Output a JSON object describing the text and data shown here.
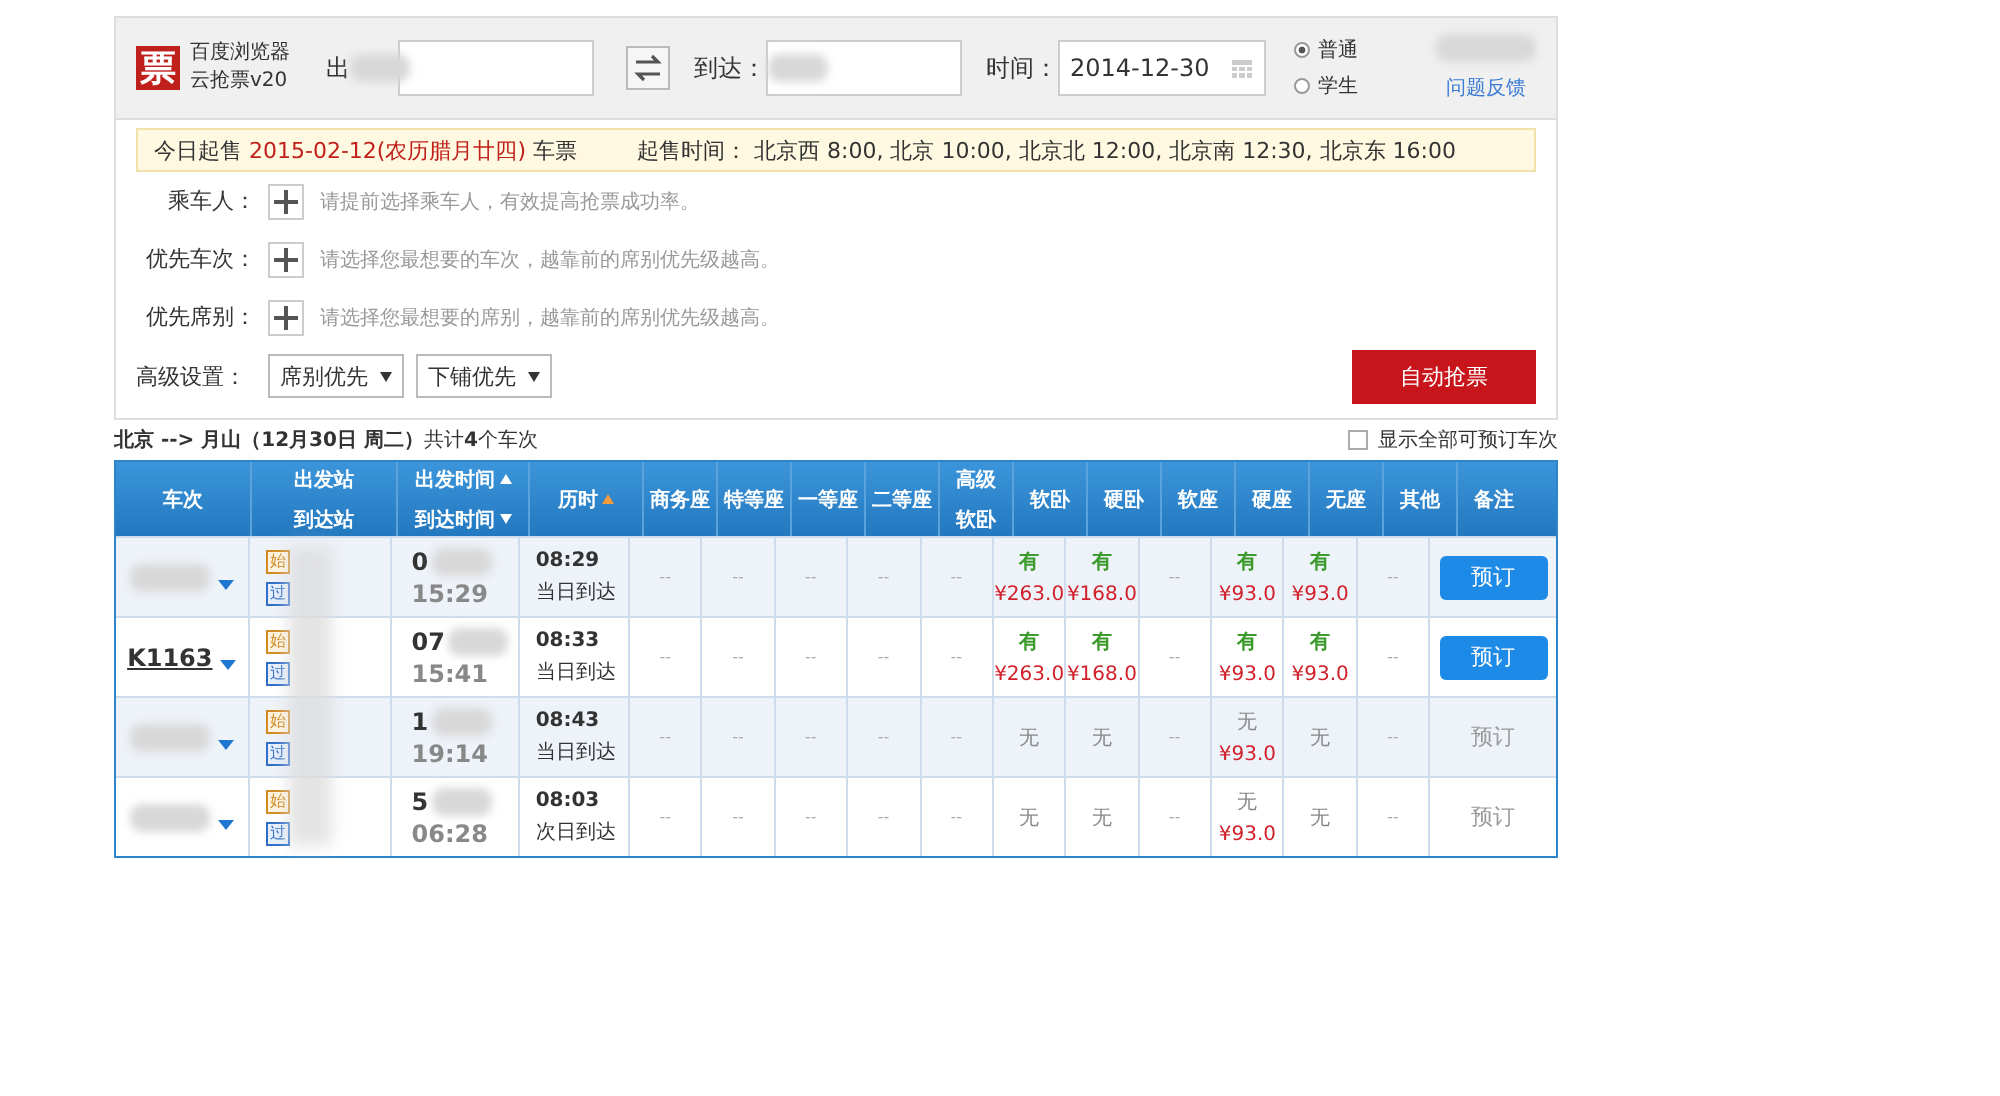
{
  "app": {
    "logo": "票",
    "name_line1": "百度浏览器",
    "name_line2": "云抢票v20"
  },
  "search": {
    "from_label": "出",
    "to_label": "到达：",
    "date_label": "时间：",
    "date": "2014-12-30",
    "ticket_types": [
      {
        "label": "普通",
        "selected": true
      },
      {
        "label": "学生",
        "selected": false
      }
    ],
    "feedback": "问题反馈"
  },
  "notice": {
    "prefix": "今日起售",
    "date": "2015-02-12(农历腊月廿四)",
    "suffix": "车票",
    "times_label": "起售时间：",
    "times": "北京西 8:00, 北京 10:00, 北京北 12:00, 北京南 12:30, 北京东 16:00"
  },
  "form_rows": [
    {
      "label": "乘车人：",
      "hint": "请提前选择乘车人，有效提高抢票成功率。"
    },
    {
      "label": "优先车次：",
      "hint": "请选择您最想要的车次，越靠前的席别优先级越高。"
    },
    {
      "label": "优先席别：",
      "hint": "请选择您最想要的席别，越靠前的席别优先级越高。"
    }
  ],
  "advanced": {
    "label": "高级设置：",
    "selects": [
      "席别优先",
      "下铺优先"
    ],
    "grab_button": "自动抢票"
  },
  "summary": "**北京 --> 月山（12月30日  周二）**共计**4**个车次",
  "show_all": {
    "label": "显示全部可预订车次",
    "checked": false
  },
  "columns": [
    {
      "lines": [
        {
          "text": "车次"
        }
      ]
    },
    {
      "lines": [
        {
          "text": "出发站"
        },
        {
          "text": "到达站"
        }
      ]
    },
    {
      "lines": [
        {
          "text": "出发时间",
          "sort_arrow": true,
          "descending": false,
          "active": false
        },
        {
          "text": "到达时间",
          "sort_arrow": true,
          "descending": true,
          "active": false
        }
      ]
    },
    {
      "lines": [
        {
          "text": "历时",
          "sort_arrow": true,
          "descending": false,
          "active": true
        }
      ]
    },
    {
      "lines": [
        {
          "text": "商务座"
        }
      ]
    },
    {
      "lines": [
        {
          "text": "特等座"
        }
      ]
    },
    {
      "lines": [
        {
          "text": "一等座"
        }
      ]
    },
    {
      "lines": [
        {
          "text": "二等座"
        }
      ]
    },
    {
      "lines": [
        {
          "text": "高级"
        },
        {
          "text": "软卧"
        }
      ]
    },
    {
      "lines": [
        {
          "text": "软卧"
        }
      ]
    },
    {
      "lines": [
        {
          "text": "硬卧"
        }
      ]
    },
    {
      "lines": [
        {
          "text": "软座"
        }
      ]
    },
    {
      "lines": [
        {
          "text": "硬座"
        }
      ]
    },
    {
      "lines": [
        {
          "text": "无座"
        }
      ]
    },
    {
      "lines": [
        {
          "text": "其他"
        }
      ]
    },
    {
      "lines": [
        {
          "text": "备注"
        }
      ]
    }
  ],
  "rows": [
    {
      "depart_shown": "0",
      "arrive": "15:29",
      "duration": "08:29",
      "arrival_day": "当日到达",
      "badges": [
        {
          "text": "始",
          "kind": "start"
        },
        {
          "text": "过",
          "kind": "pass"
        }
      ],
      "seats": [
        {
          "kind": "none",
          "status": "--"
        },
        {
          "kind": "none",
          "status": "--"
        },
        {
          "kind": "none",
          "status": "--"
        },
        {
          "kind": "none",
          "status": "--"
        },
        {
          "kind": "none",
          "status": "--"
        },
        {
          "kind": "available",
          "status": "有",
          "price": "¥263.0"
        },
        {
          "kind": "available",
          "status": "有",
          "price": "¥168.0"
        },
        {
          "kind": "none",
          "status": "--"
        },
        {
          "kind": "available",
          "status": "有",
          "price": "¥93.0"
        },
        {
          "kind": "available",
          "status": "有",
          "price": "¥93.0"
        },
        {
          "kind": "none",
          "status": "--"
        }
      ],
      "book": {
        "label": "预订",
        "enabled": true
      }
    },
    {
      "train": "K1163",
      "depart_shown": "07",
      "arrive": "15:41",
      "duration": "08:33",
      "arrival_day": "当日到达",
      "badges": [
        {
          "text": "始",
          "kind": "start"
        },
        {
          "text": "过",
          "kind": "pass"
        }
      ],
      "seats": [
        {
          "kind": "none",
          "status": "--"
        },
        {
          "kind": "none",
          "status": "--"
        },
        {
          "kind": "none",
          "status": "--"
        },
        {
          "kind": "none",
          "status": "--"
        },
        {
          "kind": "none",
          "status": "--"
        },
        {
          "kind": "available",
          "status": "有",
          "price": "¥263.0"
        },
        {
          "kind": "available",
          "status": "有",
          "price": "¥168.0"
        },
        {
          "kind": "none",
          "status": "--"
        },
        {
          "kind": "available",
          "status": "有",
          "price": "¥93.0"
        },
        {
          "kind": "available",
          "status": "有",
          "price": "¥93.0"
        },
        {
          "kind": "none",
          "status": "--"
        }
      ],
      "book": {
        "label": "预订",
        "enabled": true
      }
    },
    {
      "depart_shown": "1",
      "arrive": "19:14",
      "duration": "08:43",
      "arrival_day": "当日到达",
      "badges": [
        {
          "text": "始",
          "kind": "start"
        },
        {
          "text": "过",
          "kind": "pass"
        }
      ],
      "seats": [
        {
          "kind": "none",
          "status": "--"
        },
        {
          "kind": "none",
          "status": "--"
        },
        {
          "kind": "none",
          "status": "--"
        },
        {
          "kind": "none",
          "status": "--"
        },
        {
          "kind": "none",
          "status": "--"
        },
        {
          "kind": "soldout",
          "status": "无"
        },
        {
          "kind": "soldout",
          "status": "无"
        },
        {
          "kind": "none",
          "status": "--"
        },
        {
          "kind": "soldout",
          "status": "无",
          "price": "¥93.0"
        },
        {
          "kind": "soldout",
          "status": "无"
        },
        {
          "kind": "none",
          "status": "--"
        }
      ],
      "book": {
        "label": "预订",
        "enabled": false
      }
    },
    {
      "depart_shown": "5",
      "arrive": "06:28",
      "duration": "08:03",
      "arrival_day": "次日到达",
      "badges": [
        {
          "text": "始",
          "kind": "start"
        },
        {
          "text": "过",
          "kind": "pass"
        }
      ],
      "seats": [
        {
          "kind": "none",
          "status": "--"
        },
        {
          "kind": "none",
          "status": "--"
        },
        {
          "kind": "none",
          "status": "--"
        },
        {
          "kind": "none",
          "status": "--"
        },
        {
          "kind": "none",
          "status": "--"
        },
        {
          "kind": "soldout",
          "status": "无"
        },
        {
          "kind": "soldout",
          "status": "无"
        },
        {
          "kind": "none",
          "status": "--"
        },
        {
          "kind": "soldout",
          "status": "无",
          "price": "¥93.0"
        },
        {
          "kind": "soldout",
          "status": "无"
        },
        {
          "kind": "none",
          "status": "--"
        }
      ],
      "book": {
        "label": "预订",
        "enabled": false
      }
    }
  ]
}
